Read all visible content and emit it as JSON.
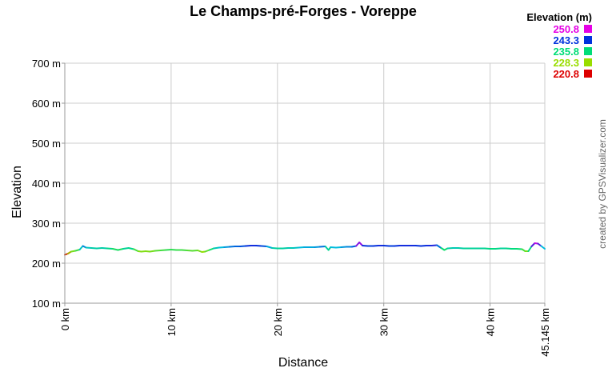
{
  "chart_data": {
    "type": "line",
    "title": "Le Champs-pré-Forges - Voreppe",
    "xlabel": "Distance",
    "ylabel": "Elevation",
    "xlim": [
      0,
      45.145
    ],
    "ylim": [
      100,
      700
    ],
    "x_ticks": [
      {
        "value": 0,
        "label": "0 km"
      },
      {
        "value": 10,
        "label": "10 km"
      },
      {
        "value": 20,
        "label": "20 km"
      },
      {
        "value": 30,
        "label": "30 km"
      },
      {
        "value": 40,
        "label": "40 km"
      },
      {
        "value": 45.145,
        "label": "45.145 km"
      }
    ],
    "y_ticks": [
      {
        "value": 100,
        "label": "100 m"
      },
      {
        "value": 200,
        "label": "200 m"
      },
      {
        "value": 300,
        "label": "300 m"
      },
      {
        "value": 400,
        "label": "400 m"
      },
      {
        "value": 500,
        "label": "500 m"
      },
      {
        "value": 600,
        "label": "600 m"
      },
      {
        "value": 700,
        "label": "700 m"
      }
    ],
    "grid": true,
    "legend": {
      "title": "Elevation (m)",
      "placement": "top-right",
      "entries": [
        {
          "label": "250.8",
          "color": "#e600e6"
        },
        {
          "label": "243.3",
          "color": "#0033dd"
        },
        {
          "label": "235.8",
          "color": "#00dd77"
        },
        {
          "label": "228.3",
          "color": "#99dd00"
        },
        {
          "label": "220.8",
          "color": "#dd0000"
        }
      ]
    },
    "color_range": [
      220.8,
      250.8
    ],
    "series": [
      {
        "x": [
          0,
          0.3,
          0.6,
          1.0,
          1.4,
          1.7,
          2.0,
          2.5,
          3.0,
          3.5,
          4.0,
          4.5,
          5.0,
          5.5,
          6.0,
          6.5,
          6.9,
          7.2,
          7.6,
          8.0,
          8.5,
          9.0,
          9.5,
          10.0,
          10.5,
          11.0,
          11.5,
          12.0,
          12.5,
          12.9,
          13.2,
          13.6,
          14.0,
          14.5,
          15.0,
          15.5,
          16.0,
          16.5,
          17.0,
          17.5,
          18.0,
          18.5,
          19.0,
          19.5,
          20.0,
          20.5,
          21.0,
          21.5,
          22.0,
          22.5,
          23.0,
          23.5,
          24.0,
          24.5,
          24.8,
          25.0,
          25.5,
          26.0,
          26.5,
          27.0,
          27.4,
          27.7,
          28.0,
          28.5,
          29.0,
          29.5,
          30.0,
          30.5,
          31.0,
          31.5,
          32.0,
          32.5,
          33.0,
          33.5,
          34.0,
          34.5,
          35.0,
          35.4,
          35.7,
          36.0,
          36.5,
          37.0,
          37.5,
          38.0,
          38.5,
          39.0,
          39.5,
          40.0,
          40.5,
          41.0,
          41.5,
          42.0,
          42.5,
          43.0,
          43.3,
          43.6,
          43.9,
          44.2,
          44.5,
          44.8,
          45.145
        ],
        "y": [
          221,
          224,
          229,
          231,
          234,
          243,
          239,
          238,
          237,
          238,
          237,
          236,
          233,
          236,
          238,
          235,
          230,
          229,
          230,
          229,
          231,
          232,
          233,
          234,
          233,
          233,
          232,
          231,
          232,
          228,
          229,
          233,
          237,
          239,
          240,
          241,
          242,
          242,
          243,
          244,
          244,
          243,
          242,
          238,
          237,
          237,
          238,
          238,
          239,
          240,
          240,
          240,
          241,
          242,
          233,
          240,
          239,
          240,
          241,
          241,
          243,
          252,
          244,
          243,
          243,
          244,
          244,
          243,
          243,
          244,
          244,
          244,
          244,
          243,
          244,
          244,
          245,
          238,
          233,
          237,
          238,
          238,
          237,
          237,
          237,
          237,
          237,
          236,
          236,
          237,
          237,
          236,
          236,
          235,
          230,
          230,
          242,
          250,
          249,
          243,
          236
        ]
      }
    ]
  },
  "credit": "created by GPSVisualizer.com"
}
